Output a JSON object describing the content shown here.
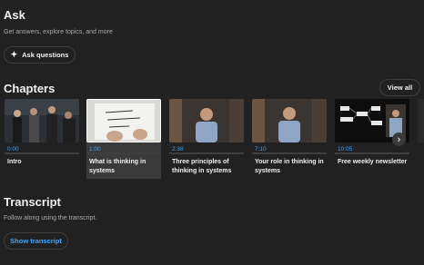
{
  "ask": {
    "title": "Ask",
    "subtitle": "Get answers, explore topics, and more",
    "button_label": "Ask questions",
    "button_icon": "sparkle-icon"
  },
  "chapters": {
    "title": "Chapters",
    "view_all_label": "View all",
    "items": [
      {
        "time": "0:00",
        "title": "Intro",
        "active": false
      },
      {
        "time": "1:00",
        "title": "What is thinking in systems",
        "active": true
      },
      {
        "time": "2:38",
        "title": "Three principles of thinking in systems",
        "active": false
      },
      {
        "time": "7:10",
        "title": "Your role in thinking in systems",
        "active": false
      },
      {
        "time": "10:05",
        "title": "Free weekly newsletter",
        "active": false
      }
    ],
    "next_icon": "chevron-right-icon"
  },
  "transcript": {
    "title": "Transcript",
    "subtitle": "Follow along using the transcript.",
    "button_label": "Show transcript"
  },
  "colors": {
    "background": "#212121",
    "accent_blue": "#3ea6ff",
    "secondary_text": "#aaaaaa"
  }
}
